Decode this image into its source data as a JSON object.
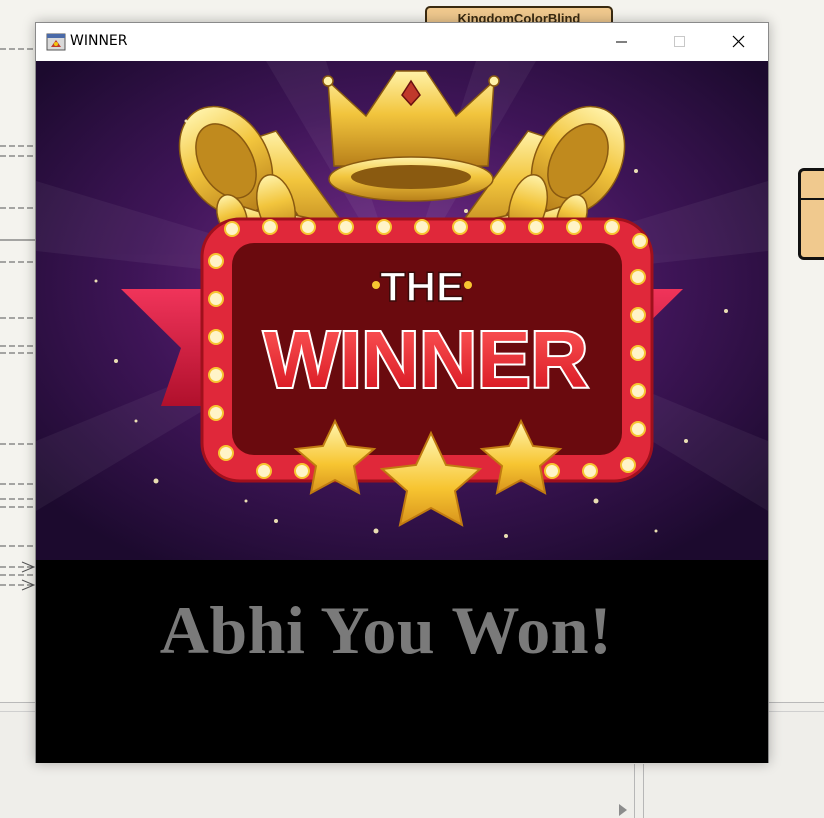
{
  "background": {
    "class_tag_label": "KingdomColorBlind"
  },
  "window": {
    "title": "WINNER",
    "controls": {
      "minimize": "minimize-icon",
      "maximize": "maximize-icon",
      "close": "close-icon"
    }
  },
  "banner": {
    "line1": "THE",
    "line2": "WINNER",
    "decorations": [
      "crown-icon",
      "trumpet-icon",
      "star-icon"
    ]
  },
  "message": {
    "text": "Abhi You Won!"
  },
  "colors": {
    "background_black": "#000000",
    "message_gray": "#7a7a7a",
    "banner_purple": "#3a1452",
    "marquee_red": "#e0283a",
    "gold": "#f2c53d"
  }
}
